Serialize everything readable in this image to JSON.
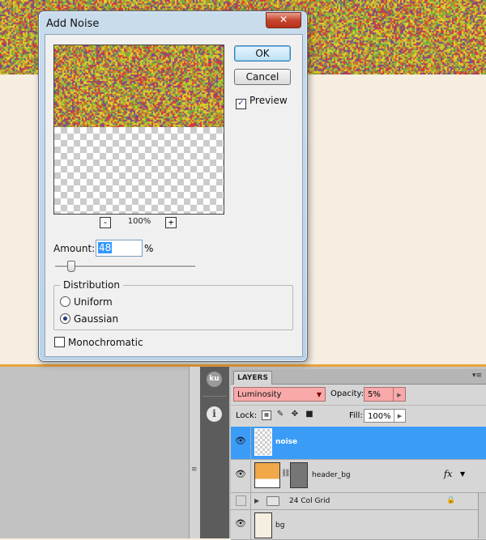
{
  "dialog": {
    "title": "Add Noise",
    "close_glyph": "✕",
    "ok_label": "OK",
    "cancel_label": "Cancel",
    "preview_label": "Preview",
    "preview_checked": true,
    "zoom_out_label": "-",
    "zoom_in_label": "+",
    "zoom_level": "100%",
    "amount_label": "Amount:",
    "amount_value": "48",
    "amount_unit": "%",
    "distribution_legend": "Distribution",
    "uniform_label": "Uniform",
    "gaussian_label": "Gaussian",
    "selected_distribution": "Gaussian",
    "monochromatic_label": "Monochromatic",
    "monochromatic_checked": false
  },
  "tools": {
    "ku_label": "ku",
    "info_label": "i"
  },
  "layers_panel": {
    "tab_label": "LAYERS",
    "menu_glyph": "▾≡",
    "blend_mode": "Luminosity",
    "opacity_label": "Opacity:",
    "opacity_value": "5%",
    "lock_label": "Lock:",
    "fill_label": "Fill:",
    "fill_value": "100%",
    "layers": [
      {
        "name": "noise",
        "selected": true,
        "visible": true
      },
      {
        "name": "header_bg",
        "selected": false,
        "visible": true,
        "has_fx": true
      },
      {
        "name": "24 Col Grid",
        "selected": false,
        "visible": false,
        "locked": true
      },
      {
        "name": "bg",
        "selected": false,
        "visible": true
      }
    ]
  },
  "colors": {
    "noise_hues": [
      "#d83a3a",
      "#e8d02a",
      "#6fae3f",
      "#b7c43c",
      "#c78a2a",
      "#7b4a8a"
    ],
    "cream": "#f6eee0",
    "header_orange": "#f0a848",
    "selection_blue": "#3b9cf8",
    "warning_pink": "#f9a9a9"
  }
}
